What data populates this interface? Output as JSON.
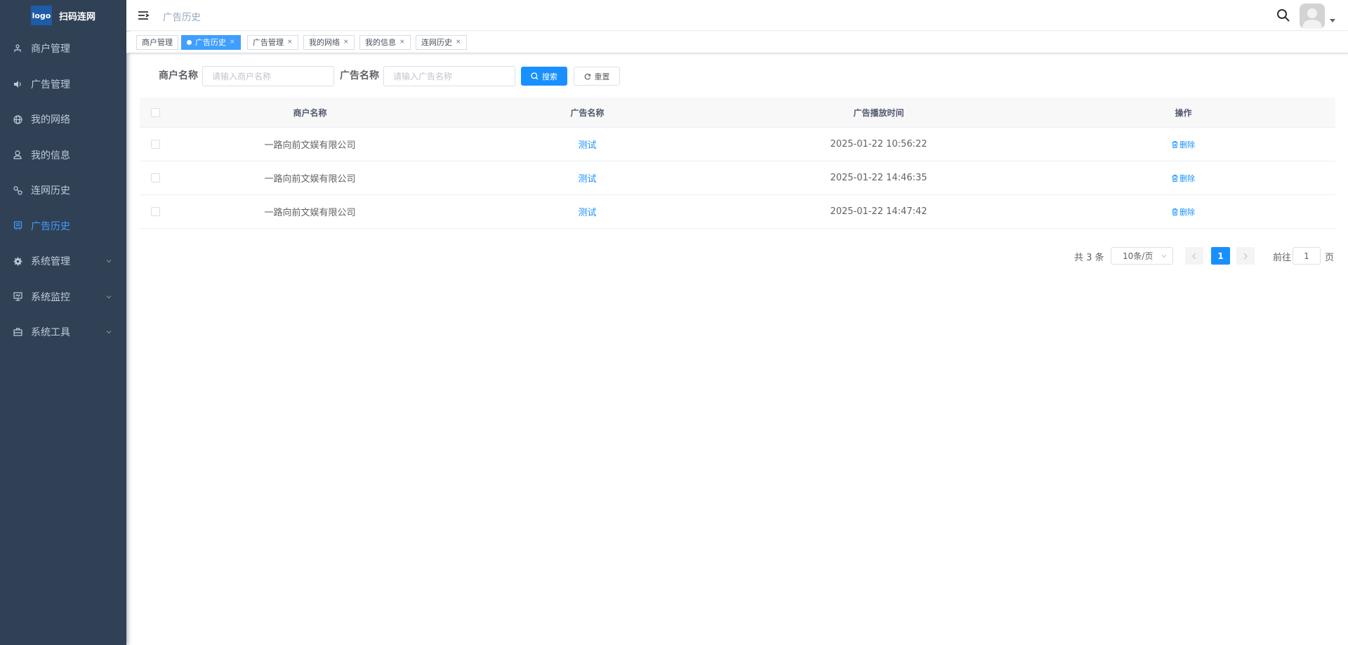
{
  "sidebar": {
    "logo_text": "logo",
    "title": "扫码连网",
    "items": [
      {
        "label": "商户管理",
        "icon": "user-tree-icon"
      },
      {
        "label": "广告管理",
        "icon": "speaker-icon"
      },
      {
        "label": "我的网络",
        "icon": "globe-icon"
      },
      {
        "label": "我的信息",
        "icon": "person-icon"
      },
      {
        "label": "连网历史",
        "icon": "link-icon"
      },
      {
        "label": "广告历史",
        "icon": "billboard-icon",
        "active": true
      },
      {
        "label": "系统管理",
        "icon": "gear-icon",
        "expandable": true
      },
      {
        "label": "系统监控",
        "icon": "monitor-icon",
        "expandable": true
      },
      {
        "label": "系统工具",
        "icon": "toolbox-icon",
        "expandable": true
      }
    ]
  },
  "header": {
    "breadcrumb": "广告历史"
  },
  "tags": [
    {
      "label": "商户管理",
      "closable": false,
      "active": false
    },
    {
      "label": "广告历史",
      "closable": true,
      "active": true
    },
    {
      "label": "广告管理",
      "closable": true,
      "active": false
    },
    {
      "label": "我的网络",
      "closable": true,
      "active": false
    },
    {
      "label": "我的信息",
      "closable": true,
      "active": false
    },
    {
      "label": "连网历史",
      "closable": true,
      "active": false
    }
  ],
  "tag_close": "×",
  "search": {
    "merchant_label": "商户名称",
    "merchant_placeholder": "请输入商户名称",
    "ad_label": "广告名称",
    "ad_placeholder": "请输入广告名称",
    "search_button": "搜索",
    "reset_button": "重置"
  },
  "table": {
    "columns": [
      "商户名称",
      "广告名称",
      "广告播放时间",
      "操作"
    ],
    "rows": [
      {
        "merchant": "一路向前文娱有限公司",
        "ad": "测试",
        "time": "2025-01-22 10:56:22",
        "action": "删除"
      },
      {
        "merchant": "一路向前文娱有限公司",
        "ad": "测试",
        "time": "2025-01-22 14:46:35",
        "action": "删除"
      },
      {
        "merchant": "一路向前文娱有限公司",
        "ad": "测试",
        "time": "2025-01-22 14:47:42",
        "action": "删除"
      }
    ]
  },
  "pagination": {
    "total": "共 3 条",
    "page_size": "10条/页",
    "current_page": "1",
    "goto_label": "前往",
    "goto_value": "1",
    "page_suffix": "页"
  },
  "colors": {
    "sidebar_bg": "#304156",
    "primary": "#1890ff",
    "active_menu": "#409eff"
  }
}
